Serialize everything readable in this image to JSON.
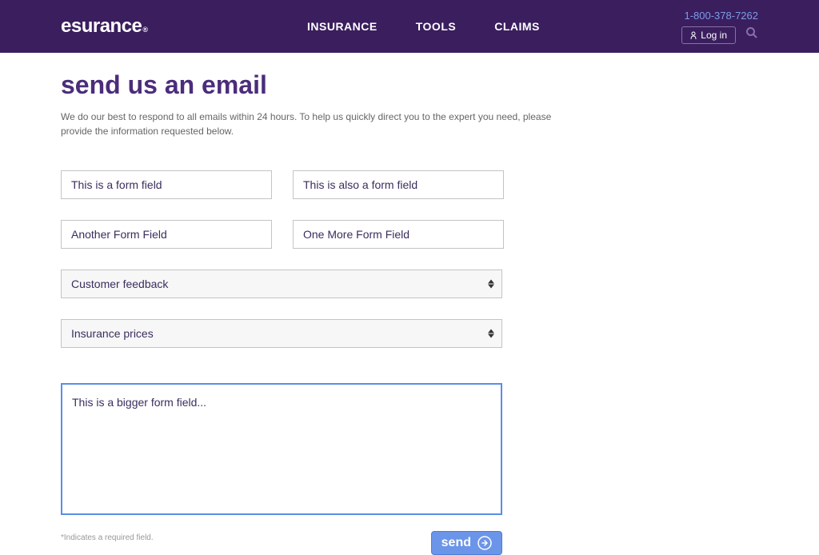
{
  "header": {
    "brand": "esurance",
    "nav": {
      "insurance": "INSURANCE",
      "tools": "TOOLS",
      "claims": "CLAIMS"
    },
    "phone": "1-800-378-7262",
    "login": "Log in"
  },
  "page": {
    "title": "send us an email",
    "subtitle": "We do our best to respond to all emails within 24 hours. To help us quickly direct you to the expert you need, please provide the information requested below."
  },
  "form": {
    "field1": "This is a form field",
    "field2": "This is also a form field",
    "field3": "Another Form Field",
    "field4": "One More Form Field",
    "select1": "Customer feedback",
    "select2": "Insurance prices",
    "textarea": "This is a bigger form field...",
    "required_note": "*Indicates a required field.",
    "send": "send"
  }
}
